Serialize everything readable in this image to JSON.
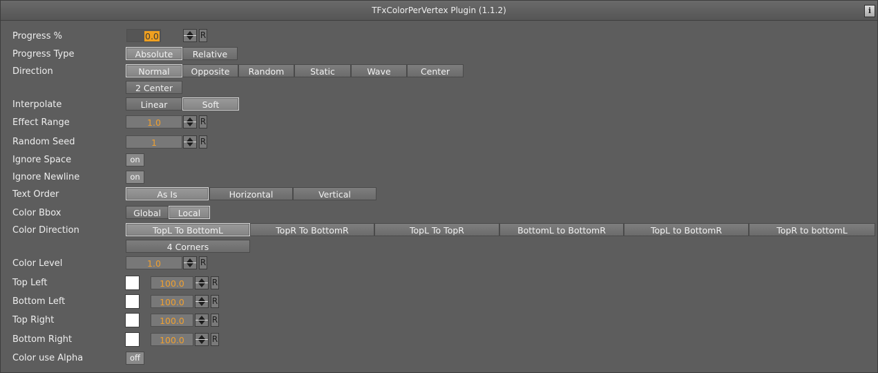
{
  "title": "TFxColorPerVertex Plugin (1.1.2)",
  "info_label": "i",
  "reset_label": "R",
  "progress": {
    "label": "Progress %",
    "value_prefix": "",
    "value_highlight": "0.0"
  },
  "progress_type": {
    "label": "Progress Type",
    "options": [
      "Absolute",
      "Relative"
    ],
    "selected": "Absolute"
  },
  "direction": {
    "label": "Direction",
    "options": [
      "Normal",
      "Opposite",
      "Random",
      "Static",
      "Wave",
      "Center",
      "2 Center"
    ],
    "selected": "Normal"
  },
  "interpolate": {
    "label": "Interpolate",
    "options": [
      "Linear",
      "Soft"
    ],
    "selected": "Soft"
  },
  "effect_range": {
    "label": "Effect Range",
    "value": "1.0"
  },
  "random_seed": {
    "label": "Random Seed",
    "value": "1"
  },
  "ignore_space": {
    "label": "Ignore Space",
    "value": "on"
  },
  "ignore_newline": {
    "label": "Ignore Newline",
    "value": "on"
  },
  "text_order": {
    "label": "Text Order",
    "options": [
      "As Is",
      "Horizontal",
      "Vertical"
    ],
    "selected": "As Is"
  },
  "color_bbox": {
    "label": "Color Bbox",
    "options": [
      "Global",
      "Local"
    ],
    "selected": "Local"
  },
  "color_direction": {
    "label": "Color Direction",
    "options": [
      "TopL To BottomL",
      "TopR To BottomR",
      "TopL To TopR",
      "BottomL to BottomR",
      "TopL to BottomR",
      "TopR to bottomL",
      "4 Corners"
    ],
    "selected": "TopL To BottomL"
  },
  "color_level": {
    "label": "Color Level",
    "value": "1.0"
  },
  "corners": [
    {
      "label": "Top Left",
      "value": "100.0",
      "color": "#ffffff"
    },
    {
      "label": "Bottom Left",
      "value": "100.0",
      "color": "#ffffff"
    },
    {
      "label": "Top Right",
      "value": "100.0",
      "color": "#ffffff"
    },
    {
      "label": "Bottom Right",
      "value": "100.0",
      "color": "#ffffff"
    }
  ],
  "color_use_alpha": {
    "label": "Color use Alpha",
    "value": "off"
  }
}
